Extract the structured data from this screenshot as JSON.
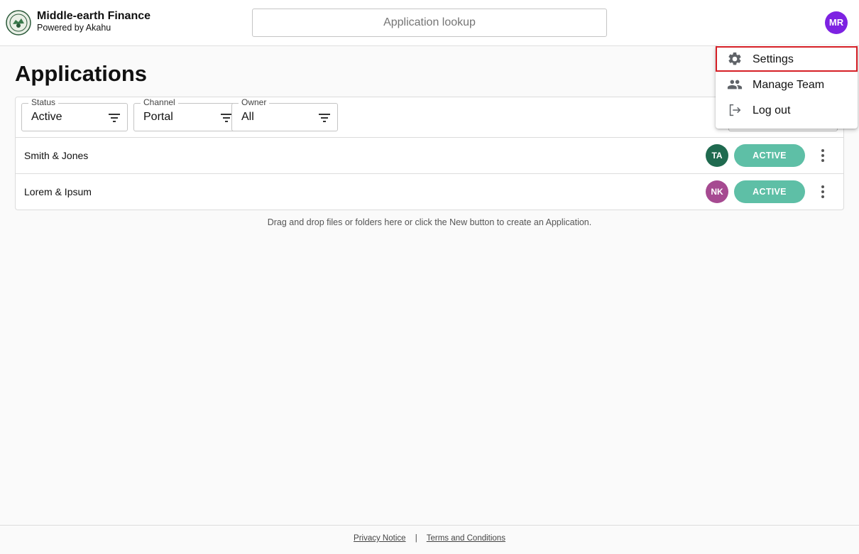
{
  "header": {
    "brand_title": "Middle-earth Finance",
    "brand_subtitle": "Powered by Akahu",
    "search_placeholder": "Application lookup",
    "user_initials": "MR",
    "user_avatar_color": "#7d22e2"
  },
  "page": {
    "title": "Applications"
  },
  "filters": [
    {
      "label": "Status",
      "value": "Active"
    },
    {
      "label": "Channel",
      "value": "Portal"
    },
    {
      "label": "Owner",
      "value": "All"
    }
  ],
  "applications": [
    {
      "name": "Smith & Jones",
      "owner_initials": "TA",
      "owner_color": "#1f6a4f",
      "status": "ACTIVE"
    },
    {
      "name": "Lorem & Ipsum",
      "owner_initials": "NK",
      "owner_color": "#a64a91",
      "status": "ACTIVE"
    }
  ],
  "status_color": "#5ebfa6",
  "hint": "Drag and drop files or folders here or click the New button to create an Application.",
  "user_menu": {
    "items": [
      {
        "label": "Settings",
        "icon": "gear-icon"
      },
      {
        "label": "Manage Team",
        "icon": "people-icon"
      },
      {
        "label": "Log out",
        "icon": "logout-icon"
      }
    ]
  },
  "footer": {
    "privacy": "Privacy Notice",
    "separator": "|",
    "terms": "Terms and Conditions"
  }
}
